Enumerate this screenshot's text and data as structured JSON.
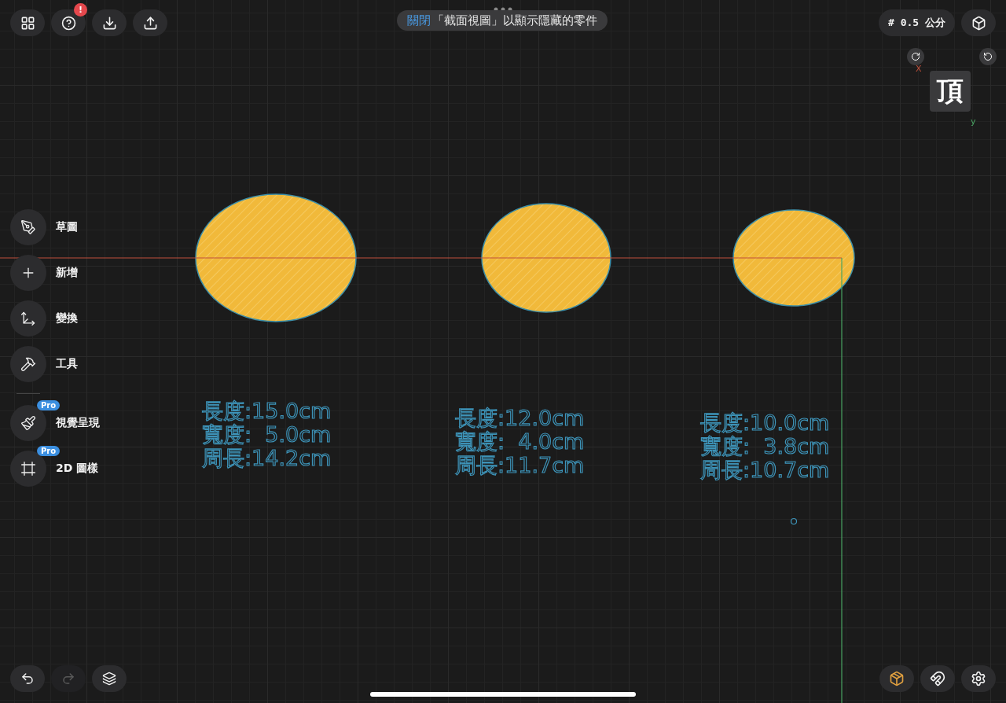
{
  "top_toolbar": {
    "buttons": [
      {
        "kind": "apps"
      },
      {
        "kind": "help",
        "badge": "!"
      },
      {
        "kind": "import"
      },
      {
        "kind": "export"
      }
    ]
  },
  "notice": {
    "action": "關閉",
    "message": "「截面視圖」以顯示隱藏的零件"
  },
  "grid_size": "# 0.5 公分",
  "view_cube": {
    "face": "頂",
    "x_label": "X",
    "y_label": "y"
  },
  "sidebar": {
    "items": [
      {
        "kind": "sketch",
        "label": "草圖"
      },
      {
        "kind": "add",
        "label": "新增"
      },
      {
        "kind": "transform",
        "label": "變換"
      },
      {
        "kind": "tools",
        "label": "工具"
      },
      {
        "kind": "divider"
      },
      {
        "kind": "render",
        "label": "視覺呈現",
        "badge": "Pro"
      },
      {
        "kind": "drawing",
        "label": "2D 圖樣",
        "badge": "Pro"
      }
    ]
  },
  "shapes": [
    {
      "measurements": [
        "長度:15.0cm",
        "寬度:  5.0cm",
        "周長:14.2cm"
      ]
    },
    {
      "measurements": [
        "長度:12.0cm",
        "寬度:  4.0cm",
        "周長:11.7cm"
      ]
    },
    {
      "measurements": [
        "長度:10.0cm",
        "寬度:  3.8cm",
        "周長:10.7cm"
      ]
    }
  ],
  "bottom_left": [
    {
      "kind": "undo",
      "disabled": false
    },
    {
      "kind": "redo",
      "disabled": true
    },
    {
      "kind": "layers",
      "disabled": false
    }
  ],
  "bottom_right": [
    {
      "kind": "material"
    },
    {
      "kind": "snap"
    },
    {
      "kind": "settings"
    }
  ]
}
